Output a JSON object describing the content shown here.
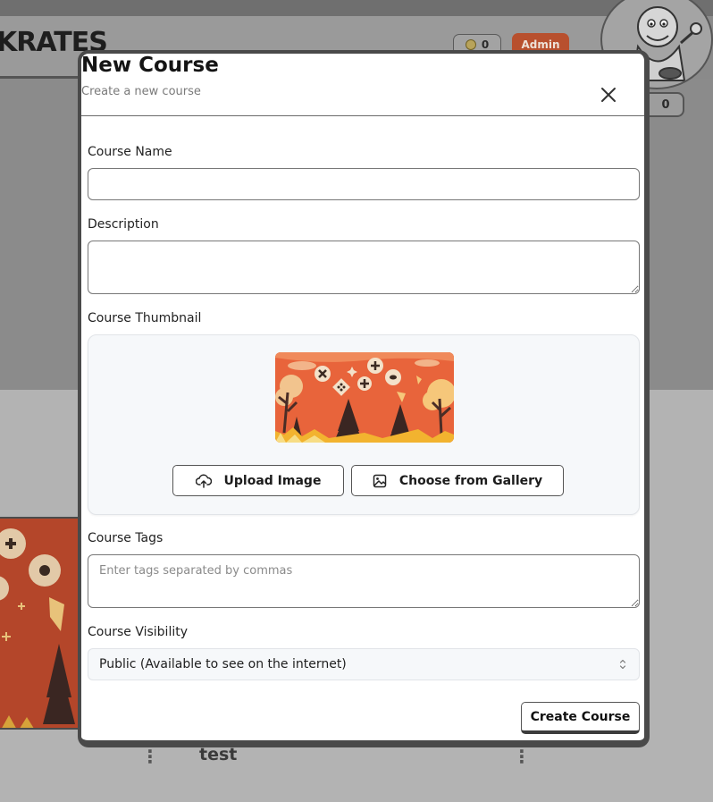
{
  "background": {
    "logo_text": "KRATES",
    "coin_count": "0",
    "admin_label": "Admin",
    "level_count": "0",
    "card_title": "test"
  },
  "modal": {
    "title": "New Course",
    "subtitle": "Create a new course",
    "close_icon": "close-icon"
  },
  "form": {
    "course_name": {
      "label": "Course Name",
      "value": "",
      "placeholder": ""
    },
    "description": {
      "label": "Description",
      "value": "",
      "placeholder": ""
    },
    "thumbnail": {
      "label": "Course Thumbnail",
      "upload_label": "Upload Image",
      "upload_icon": "upload-cloud-icon",
      "gallery_label": "Choose from Gallery",
      "gallery_icon": "image-icon"
    },
    "tags": {
      "label": "Course Tags",
      "value": "",
      "placeholder": "Enter tags separated by commas"
    },
    "visibility": {
      "label": "Course Visibility",
      "selected": "Public (Available to see on the internet)"
    },
    "submit_label": "Create Course"
  },
  "colors": {
    "thumbnail_orange": "#e8643b",
    "admin_badge": "#b8502e",
    "overlay_gray": "#8a8a8a"
  }
}
